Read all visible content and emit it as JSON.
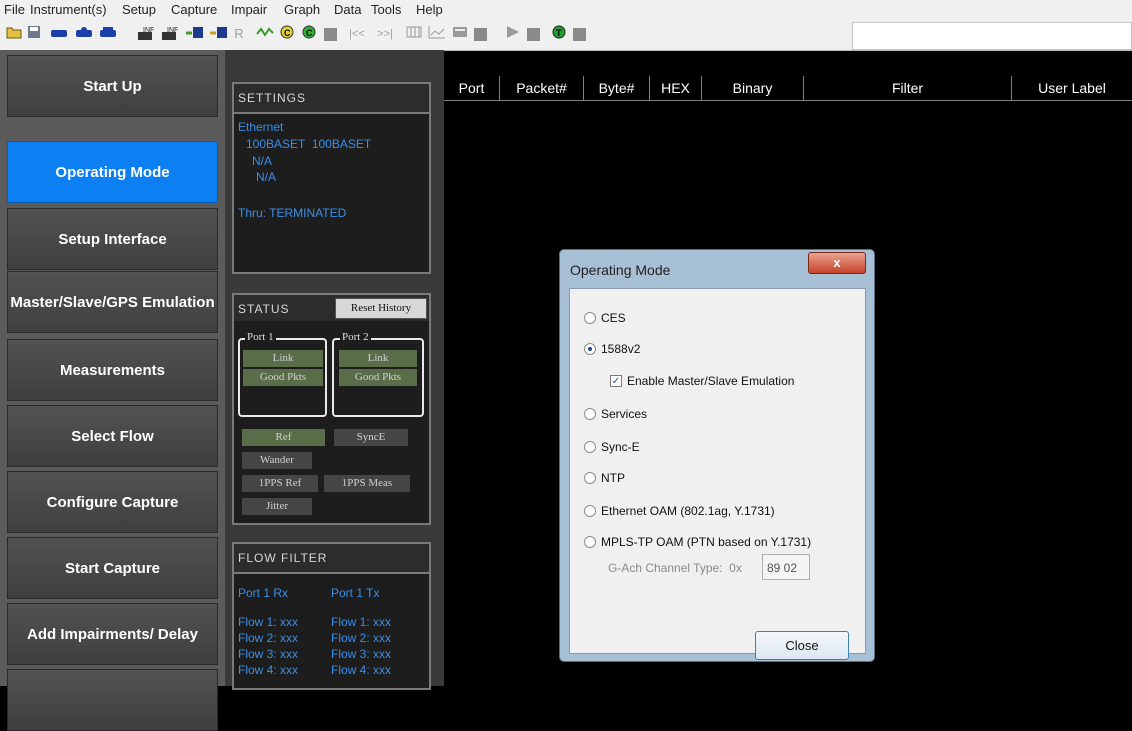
{
  "menu": [
    "File",
    "Instrument(s)",
    "Setup",
    "Capture",
    "Impair",
    "Graph",
    "Data",
    "Tools",
    "Help"
  ],
  "toolbar": {
    "r_label": "R",
    "nav_first": "|<<",
    "nav_last": ">>|"
  },
  "nav": {
    "items": [
      "Start Up",
      "Operating Mode",
      "Setup Interface",
      "Master/Slave/GPS Emulation",
      "Measurements",
      "Select Flow",
      "Configure Capture",
      "Start Capture",
      "Add Impairments/ Delay"
    ],
    "active_index": 1
  },
  "settings": {
    "title": "SETTINGS",
    "line1": "Ethernet",
    "line2": "100BASET  100BASET",
    "line3": "N/A",
    "line4": "N/A",
    "line5": "Thru: TERMINATED"
  },
  "status": {
    "title": "STATUS",
    "reset_label": "Reset History",
    "port1": "Port 1",
    "port2": "Port 2",
    "link": "Link",
    "good_pkts": "Good Pkts",
    "ref": "Ref",
    "synce": "SyncE",
    "wander": "Wander",
    "pps_ref": "1PPS Ref",
    "pps_meas": "1PPS Meas",
    "jitter": "Jitter"
  },
  "flow_filter": {
    "title": "FLOW FILTER",
    "rx_head": "Port 1 Rx",
    "tx_head": "Port 1 Tx",
    "flows": [
      "Flow 1: xxx",
      "Flow 2: xxx",
      "Flow 3: xxx",
      "Flow 4: xxx"
    ]
  },
  "columns": [
    "Port",
    "Packet#",
    "Byte#",
    "HEX",
    "Binary",
    "Filter",
    "User Label"
  ],
  "dialog": {
    "title": "Operating Mode",
    "x_label": "x",
    "options": [
      "CES",
      "1588v2",
      "Services",
      "Sync-E",
      "NTP",
      "Ethernet OAM (802.1ag, Y.1731)",
      "MPLS-TP OAM (PTN based on Y.1731)"
    ],
    "selected": "1588v2",
    "checkbox_label": "Enable Master/Slave Emulation",
    "checkbox_mark": "✓",
    "gach_label": "G-Ach Channel Type:  0x",
    "gach_value": "89 02",
    "close_label": "Close"
  }
}
